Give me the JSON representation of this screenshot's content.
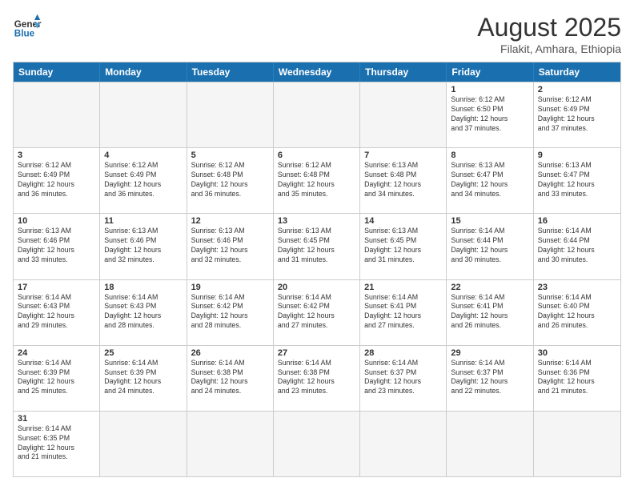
{
  "logo": {
    "text_general": "General",
    "text_blue": "Blue"
  },
  "header": {
    "month": "August 2025",
    "location": "Filakit, Amhara, Ethiopia"
  },
  "weekdays": [
    "Sunday",
    "Monday",
    "Tuesday",
    "Wednesday",
    "Thursday",
    "Friday",
    "Saturday"
  ],
  "rows": [
    {
      "cells": [
        {
          "day": "",
          "info": "",
          "empty": true
        },
        {
          "day": "",
          "info": "",
          "empty": true
        },
        {
          "day": "",
          "info": "",
          "empty": true
        },
        {
          "day": "",
          "info": "",
          "empty": true
        },
        {
          "day": "",
          "info": "",
          "empty": true
        },
        {
          "day": "1",
          "info": "Sunrise: 6:12 AM\nSunset: 6:50 PM\nDaylight: 12 hours\nand 37 minutes."
        },
        {
          "day": "2",
          "info": "Sunrise: 6:12 AM\nSunset: 6:49 PM\nDaylight: 12 hours\nand 37 minutes."
        }
      ]
    },
    {
      "cells": [
        {
          "day": "3",
          "info": "Sunrise: 6:12 AM\nSunset: 6:49 PM\nDaylight: 12 hours\nand 36 minutes."
        },
        {
          "day": "4",
          "info": "Sunrise: 6:12 AM\nSunset: 6:49 PM\nDaylight: 12 hours\nand 36 minutes."
        },
        {
          "day": "5",
          "info": "Sunrise: 6:12 AM\nSunset: 6:48 PM\nDaylight: 12 hours\nand 36 minutes."
        },
        {
          "day": "6",
          "info": "Sunrise: 6:12 AM\nSunset: 6:48 PM\nDaylight: 12 hours\nand 35 minutes."
        },
        {
          "day": "7",
          "info": "Sunrise: 6:13 AM\nSunset: 6:48 PM\nDaylight: 12 hours\nand 34 minutes."
        },
        {
          "day": "8",
          "info": "Sunrise: 6:13 AM\nSunset: 6:47 PM\nDaylight: 12 hours\nand 34 minutes."
        },
        {
          "day": "9",
          "info": "Sunrise: 6:13 AM\nSunset: 6:47 PM\nDaylight: 12 hours\nand 33 minutes."
        }
      ]
    },
    {
      "cells": [
        {
          "day": "10",
          "info": "Sunrise: 6:13 AM\nSunset: 6:46 PM\nDaylight: 12 hours\nand 33 minutes."
        },
        {
          "day": "11",
          "info": "Sunrise: 6:13 AM\nSunset: 6:46 PM\nDaylight: 12 hours\nand 32 minutes."
        },
        {
          "day": "12",
          "info": "Sunrise: 6:13 AM\nSunset: 6:46 PM\nDaylight: 12 hours\nand 32 minutes."
        },
        {
          "day": "13",
          "info": "Sunrise: 6:13 AM\nSunset: 6:45 PM\nDaylight: 12 hours\nand 31 minutes."
        },
        {
          "day": "14",
          "info": "Sunrise: 6:13 AM\nSunset: 6:45 PM\nDaylight: 12 hours\nand 31 minutes."
        },
        {
          "day": "15",
          "info": "Sunrise: 6:14 AM\nSunset: 6:44 PM\nDaylight: 12 hours\nand 30 minutes."
        },
        {
          "day": "16",
          "info": "Sunrise: 6:14 AM\nSunset: 6:44 PM\nDaylight: 12 hours\nand 30 minutes."
        }
      ]
    },
    {
      "cells": [
        {
          "day": "17",
          "info": "Sunrise: 6:14 AM\nSunset: 6:43 PM\nDaylight: 12 hours\nand 29 minutes."
        },
        {
          "day": "18",
          "info": "Sunrise: 6:14 AM\nSunset: 6:43 PM\nDaylight: 12 hours\nand 28 minutes."
        },
        {
          "day": "19",
          "info": "Sunrise: 6:14 AM\nSunset: 6:42 PM\nDaylight: 12 hours\nand 28 minutes."
        },
        {
          "day": "20",
          "info": "Sunrise: 6:14 AM\nSunset: 6:42 PM\nDaylight: 12 hours\nand 27 minutes."
        },
        {
          "day": "21",
          "info": "Sunrise: 6:14 AM\nSunset: 6:41 PM\nDaylight: 12 hours\nand 27 minutes."
        },
        {
          "day": "22",
          "info": "Sunrise: 6:14 AM\nSunset: 6:41 PM\nDaylight: 12 hours\nand 26 minutes."
        },
        {
          "day": "23",
          "info": "Sunrise: 6:14 AM\nSunset: 6:40 PM\nDaylight: 12 hours\nand 26 minutes."
        }
      ]
    },
    {
      "cells": [
        {
          "day": "24",
          "info": "Sunrise: 6:14 AM\nSunset: 6:39 PM\nDaylight: 12 hours\nand 25 minutes."
        },
        {
          "day": "25",
          "info": "Sunrise: 6:14 AM\nSunset: 6:39 PM\nDaylight: 12 hours\nand 24 minutes."
        },
        {
          "day": "26",
          "info": "Sunrise: 6:14 AM\nSunset: 6:38 PM\nDaylight: 12 hours\nand 24 minutes."
        },
        {
          "day": "27",
          "info": "Sunrise: 6:14 AM\nSunset: 6:38 PM\nDaylight: 12 hours\nand 23 minutes."
        },
        {
          "day": "28",
          "info": "Sunrise: 6:14 AM\nSunset: 6:37 PM\nDaylight: 12 hours\nand 23 minutes."
        },
        {
          "day": "29",
          "info": "Sunrise: 6:14 AM\nSunset: 6:37 PM\nDaylight: 12 hours\nand 22 minutes."
        },
        {
          "day": "30",
          "info": "Sunrise: 6:14 AM\nSunset: 6:36 PM\nDaylight: 12 hours\nand 21 minutes."
        }
      ]
    },
    {
      "cells": [
        {
          "day": "31",
          "info": "Sunrise: 6:14 AM\nSunset: 6:35 PM\nDaylight: 12 hours\nand 21 minutes."
        },
        {
          "day": "",
          "info": "",
          "empty": true
        },
        {
          "day": "",
          "info": "",
          "empty": true
        },
        {
          "day": "",
          "info": "",
          "empty": true
        },
        {
          "day": "",
          "info": "",
          "empty": true
        },
        {
          "day": "",
          "info": "",
          "empty": true
        },
        {
          "day": "",
          "info": "",
          "empty": true
        }
      ]
    }
  ]
}
